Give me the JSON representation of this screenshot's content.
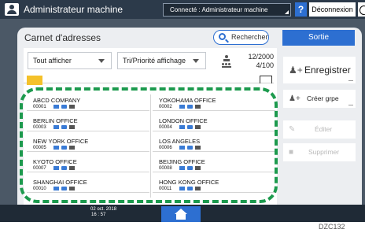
{
  "header": {
    "user_name": "Administrateur machine",
    "connection_status": "Connecté : Administrateur machine",
    "help_label": "?",
    "logout_label": "Déconnexion"
  },
  "page": {
    "title": "Carnet d'adresses",
    "search_label": "Rechercher",
    "exit_label": "Sortie"
  },
  "filters": {
    "display_select": "Tout afficher",
    "sort_select": "Tri/Priorité affichage",
    "count_current": "12/2000",
    "count_groups": "4/100"
  },
  "entries": [
    {
      "name": "ABCD COMPANY",
      "id": "00001"
    },
    {
      "name": "YOKOHAMA OFFICE",
      "id": "00002"
    },
    {
      "name": "BERLIN OFFICE",
      "id": "00003"
    },
    {
      "name": "LONDON OFFICE",
      "id": "00004"
    },
    {
      "name": "NEW YORK OFFICE",
      "id": "00005"
    },
    {
      "name": "LOS ANGELES",
      "id": "00006"
    },
    {
      "name": "KYOTO OFFICE",
      "id": "00007"
    },
    {
      "name": "BEIJING OFFICE",
      "id": "00008"
    },
    {
      "name": "SHANGHAI OFFICE",
      "id": "00010"
    },
    {
      "name": "HONG KONG OFFICE",
      "id": "00011"
    }
  ],
  "actions": {
    "register_label": "Enregistrer",
    "create_group_label": "Créer grpe",
    "edit_label": "Éditer",
    "delete_label": "Supprimer"
  },
  "footer": {
    "date": "02 oct. 2018",
    "time": "16 : 57"
  },
  "figure_code": "DZC132",
  "colors": {
    "accent_blue": "#2d6fd1",
    "highlight_dash": "#1d9a4e",
    "tab_yellow": "#f4c12a"
  }
}
